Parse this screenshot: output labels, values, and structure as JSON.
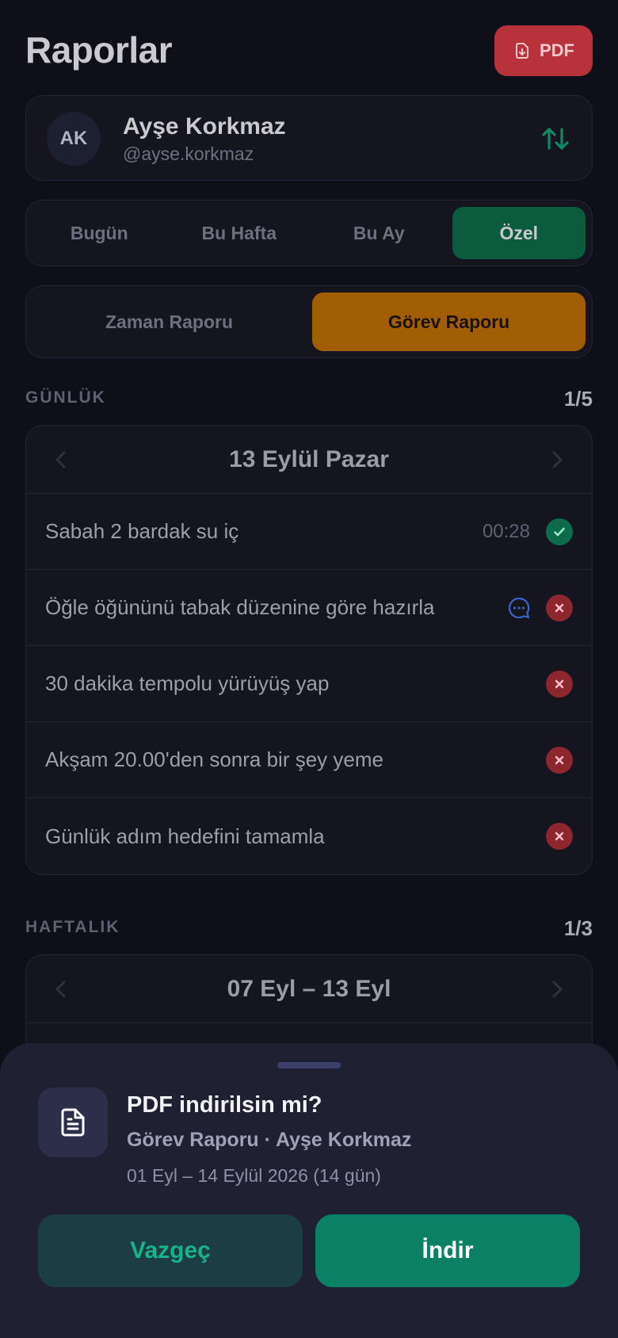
{
  "header": {
    "title": "Raporlar",
    "pdf_label": "PDF"
  },
  "user": {
    "initials": "AK",
    "name": "Ayşe Korkmaz",
    "handle": "@ayse.korkmaz"
  },
  "period_tabs": {
    "items": [
      "Bugün",
      "Bu Hafta",
      "Bu Ay",
      "Özel"
    ],
    "active": "Özel"
  },
  "report_tabs": {
    "items": [
      "Zaman Raporu",
      "Görev Raporu"
    ],
    "active": "Görev Raporu"
  },
  "daily": {
    "label": "GÜNLÜK",
    "count": "1/5",
    "date": "13 Eylül Pazar",
    "tasks": [
      {
        "text": "Sabah 2 bardak su iç",
        "time": "00:28",
        "status": "done"
      },
      {
        "text": "Öğle öğününü tabak düzenine göre hazırla",
        "note": true,
        "status": "missed"
      },
      {
        "text": "30 dakika tempolu yürüyüş yap",
        "status": "missed"
      },
      {
        "text": "Akşam 20.00'den sonra bir şey yeme",
        "status": "missed"
      },
      {
        "text": "Günlük adım hedefini tamamla",
        "status": "missed"
      }
    ]
  },
  "weekly": {
    "label": "HAFTALIK",
    "count": "1/3",
    "date": "07 Eyl – 13 Eyl"
  },
  "sheet": {
    "title": "PDF indirilsin mi?",
    "subtitle": "Görev Raporu · Ayşe Korkmaz",
    "range": "01 Eyl – 14 Eylül 2026 (14 gün)",
    "cancel_label": "Vazgeç",
    "confirm_label": "İndir"
  },
  "colors": {
    "accent_green": "#0b8065",
    "accent_amber": "#a15e05",
    "danger": "#b8323c"
  }
}
